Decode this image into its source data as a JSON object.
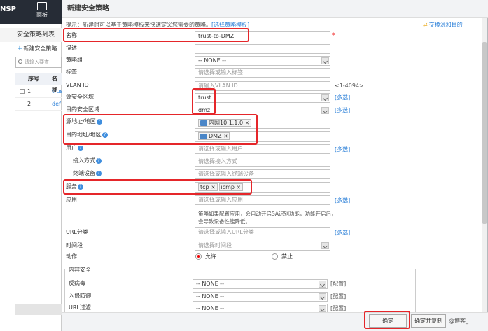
{
  "app": {
    "brand": "NSP",
    "dashboard_label": "面板"
  },
  "left_panel": {
    "title": "安全策略列表",
    "add_label": "新建安全策略",
    "search_placeholder": "请输入要查",
    "col_seq": "序号",
    "col_name": "名称",
    "rows": [
      {
        "seq": "1",
        "name": "trus"
      },
      {
        "seq": "2",
        "name": "def"
      }
    ]
  },
  "dialog": {
    "title": "新建安全策略",
    "tip": "提示：新建时可以基于策略模板来快速定义您需要的策略。",
    "tip_link": "[选择策略模板]",
    "swap_label": "交换源和目的",
    "more_label": "[多选]",
    "config_label": "[配置]",
    "fields": {
      "name": {
        "label": "名称",
        "value": "trust-to-DMZ",
        "required": "*"
      },
      "desc": {
        "label": "描述",
        "value": ""
      },
      "group": {
        "label": "策略组",
        "value": "-- NONE --"
      },
      "tag": {
        "label": "标签",
        "placeholder": "请选择或输入标签"
      },
      "vlan": {
        "label": "VLAN ID",
        "placeholder": "请输入VLAN ID",
        "hint": "<1-4094>"
      },
      "src_zone": {
        "label": "源安全区域",
        "value": "trust"
      },
      "dst_zone": {
        "label": "目的安全区域",
        "value": "dmz"
      },
      "src_addr": {
        "label": "源地址/地区",
        "tag": "内网10.1.1.0"
      },
      "dst_addr": {
        "label": "目的地址/地区",
        "tag": "DMZ"
      },
      "user": {
        "label": "用户",
        "placeholder": "请选择或输入用户"
      },
      "access": {
        "label": "接入方式",
        "placeholder": "请选择接入方式"
      },
      "device": {
        "label": "终端设备",
        "placeholder": "请选择或输入终端设备"
      },
      "service": {
        "label": "服务",
        "tags": [
          "tcp",
          "icmp"
        ]
      },
      "app": {
        "label": "应用",
        "placeholder": "请选择或输入应用",
        "note": "策略如果配置应用，会自动开启SA识别功能，功能开启后，会导致设备性能降低。"
      },
      "url": {
        "label": "URL分类",
        "placeholder": "请选择或输入URL分类"
      },
      "time": {
        "label": "时间段",
        "placeholder": "请选择时间段"
      },
      "action": {
        "label": "动作",
        "allow": "允许",
        "deny": "禁止"
      }
    },
    "content_security": {
      "title": "内容安全",
      "antivirus": {
        "label": "反病毒",
        "value": "-- NONE --"
      },
      "ips": {
        "label": "入侵防御",
        "value": "-- NONE --"
      },
      "url_filter": {
        "label": "URL过滤",
        "value": "-- NONE --"
      }
    },
    "buttons": {
      "ok": "确定",
      "cancel": "确定并复制",
      "watermark": "@博客_"
    }
  },
  "colors": {
    "highlight": "#e5262a",
    "link": "#2a7fd8",
    "topbar": "#262c36"
  }
}
